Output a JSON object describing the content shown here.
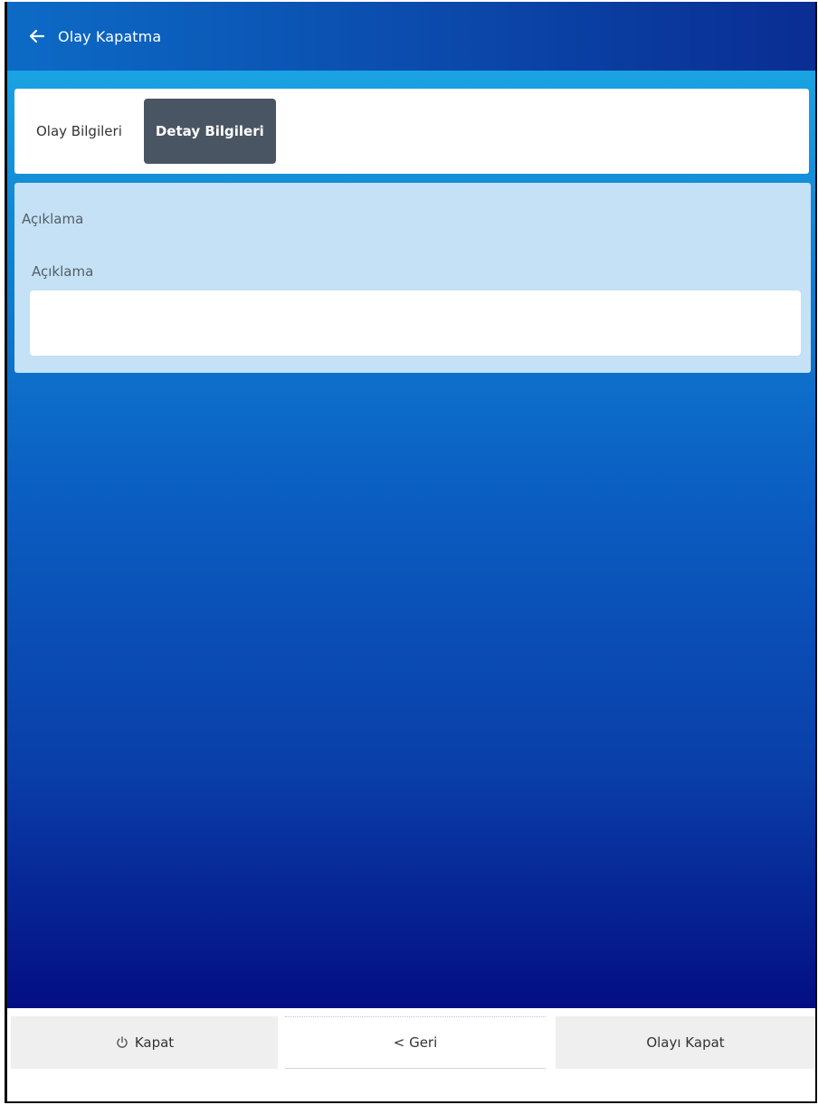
{
  "header": {
    "title": "Olay Kapatma",
    "back_icon": "arrow-left-icon"
  },
  "tabs": [
    {
      "label": "Olay Bilgileri",
      "active": false
    },
    {
      "label": "Detay Bilgileri",
      "active": true
    }
  ],
  "description_section": {
    "title": "Açıklama",
    "field_label": "Açıklama",
    "field_value": ""
  },
  "footer": {
    "close_label": "Kapat",
    "close_icon": "power-icon",
    "back_label": "< Geri",
    "close_incident_label": "Olayı Kapat"
  },
  "colors": {
    "header_gradient": [
      "#0c6bc6",
      "#0a2d93"
    ],
    "active_tab": "#4a5563",
    "panel": "#c4e1f5",
    "footer_button": "#efefef"
  }
}
